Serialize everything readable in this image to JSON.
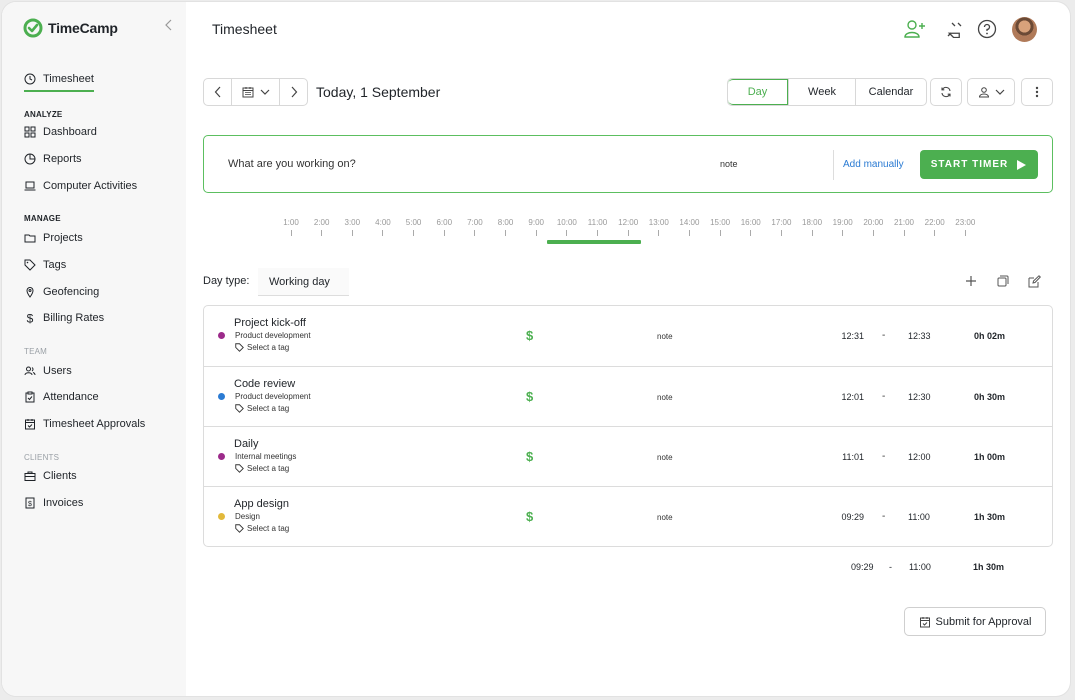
{
  "app": {
    "logo_text": "TimeCamp",
    "accent": "#4caf50"
  },
  "sidebar": {
    "timesheet": "Timesheet",
    "analyze_header": "ANALYZE",
    "dashboard": "Dashboard",
    "reports": "Reports",
    "computer_activities": "Computer Activities",
    "manage_header": "MANAGE",
    "projects": "Projects",
    "tags": "Tags",
    "geofencing": "Geofencing",
    "billing_rates": "Billing Rates",
    "team_header": "TEAM",
    "users": "Users",
    "attendance": "Attendance",
    "timesheet_approvals": "Timesheet Approvals",
    "clients_header": "CLIENTS",
    "clients": "Clients",
    "invoices": "Invoices"
  },
  "header": {
    "title": "Timesheet"
  },
  "toolbar": {
    "date_label": "Today, 1 September",
    "view_day": "Day",
    "view_week": "Week",
    "view_calendar": "Calendar"
  },
  "timer": {
    "prompt": "What are you working on?",
    "note": "note",
    "add_manually": "Add manually",
    "start_label": "START TIMER"
  },
  "timeline": {
    "hours": [
      "1:00",
      "2:00",
      "3:00",
      "4:00",
      "5:00",
      "6:00",
      "7:00",
      "8:00",
      "9:00",
      "10:00",
      "11:00",
      "12:00",
      "13:00",
      "14:00",
      "15:00",
      "16:00",
      "17:00",
      "18:00",
      "19:00",
      "20:00",
      "21:00",
      "22:00",
      "23:00"
    ]
  },
  "day_type": {
    "label": "Day type:",
    "value": "Working day"
  },
  "entries": [
    {
      "name": "Project kick-off",
      "project": "Product development",
      "tag": "Select a tag",
      "color": "#9c2a8a",
      "note": "note",
      "start": "12:31",
      "end": "12:33",
      "duration": "0h 02m"
    },
    {
      "name": "Code review",
      "project": "Product development",
      "tag": "Select a tag",
      "color": "#2b7bd3",
      "note": "note",
      "start": "12:01",
      "end": "12:30",
      "duration": "0h 30m"
    },
    {
      "name": "Daily",
      "project": "Internal meetings",
      "tag": "Select a tag",
      "color": "#9c2a8a",
      "note": "note",
      "start": "11:01",
      "end": "12:00",
      "duration": "1h 00m"
    },
    {
      "name": "App design",
      "project": "Design",
      "tag": "Select a tag",
      "color": "#e2b93b",
      "note": "note",
      "start": "09:29",
      "end": "11:00",
      "duration": "1h 30m"
    }
  ],
  "symbols": {
    "billable": "$",
    "dash": "-"
  },
  "totals": {
    "start": "09:29",
    "end": "11:00",
    "duration": "1h 30m"
  },
  "submit_label": "Submit for Approval"
}
